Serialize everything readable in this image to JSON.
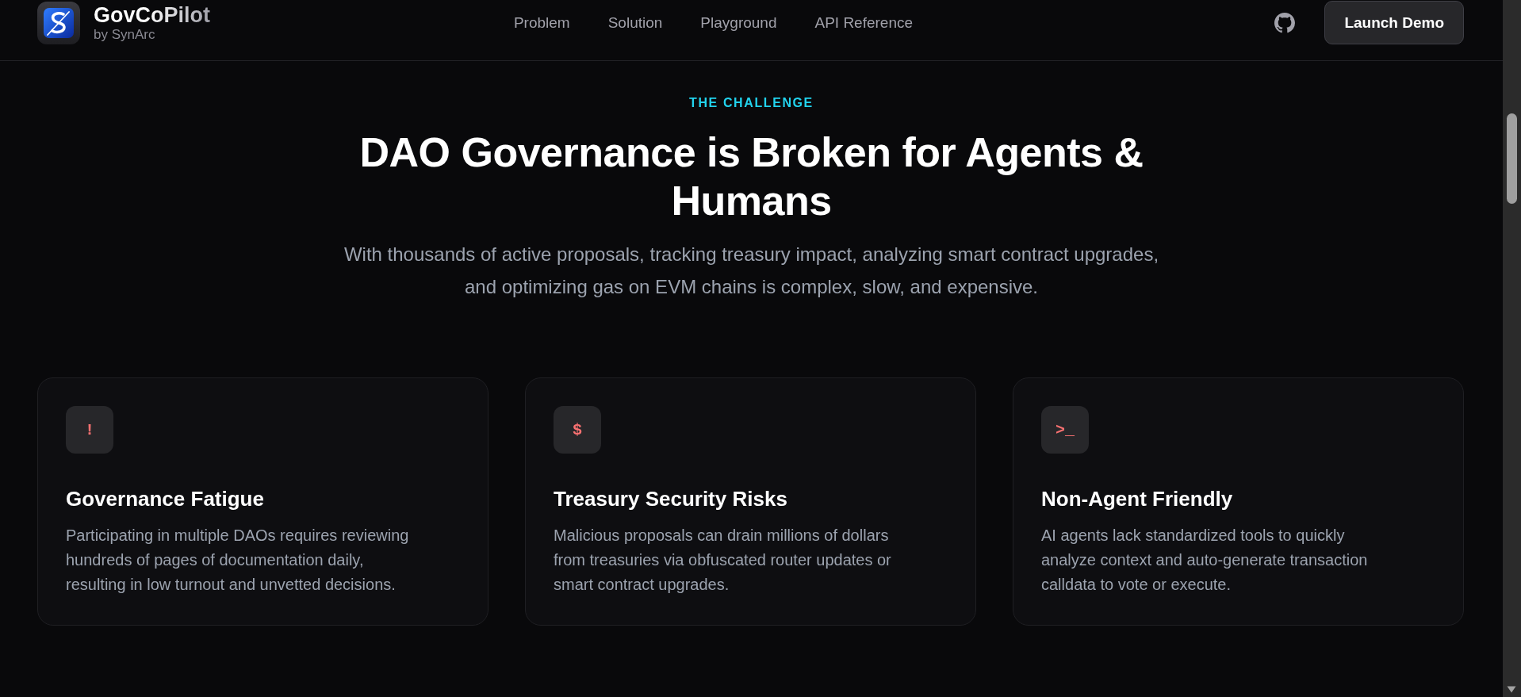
{
  "brand": {
    "name": "GovCoPilot",
    "tagline": "by SynArc"
  },
  "nav": {
    "links": [
      "Problem",
      "Solution",
      "Playground",
      "API Reference"
    ],
    "launch_button": "Launch Demo"
  },
  "section": {
    "eyebrow": "THE CHALLENGE",
    "title": "DAO Governance is Broken for Agents & Humans",
    "subtitle": "With thousands of active proposals, tracking treasury impact, analyzing smart contract upgrades, and optimizing gas on EVM chains is complex, slow, and expensive."
  },
  "cards": [
    {
      "symbol": "!",
      "title": "Governance Fatigue",
      "text": "Participating in multiple DAOs requires reviewing hundreds of pages of documentation daily, resulting in low turnout and unvetted decisions."
    },
    {
      "symbol": "$",
      "title": "Treasury Security Risks",
      "text": "Malicious proposals can drain millions of dollars from treasuries via obfuscated router updates or smart contract upgrades."
    },
    {
      "symbol": ">_",
      "title": "Non-Agent Friendly",
      "text": "AI agents lack standardized tools to quickly analyze context and auto-generate transaction calldata to vote or execute."
    }
  ]
}
